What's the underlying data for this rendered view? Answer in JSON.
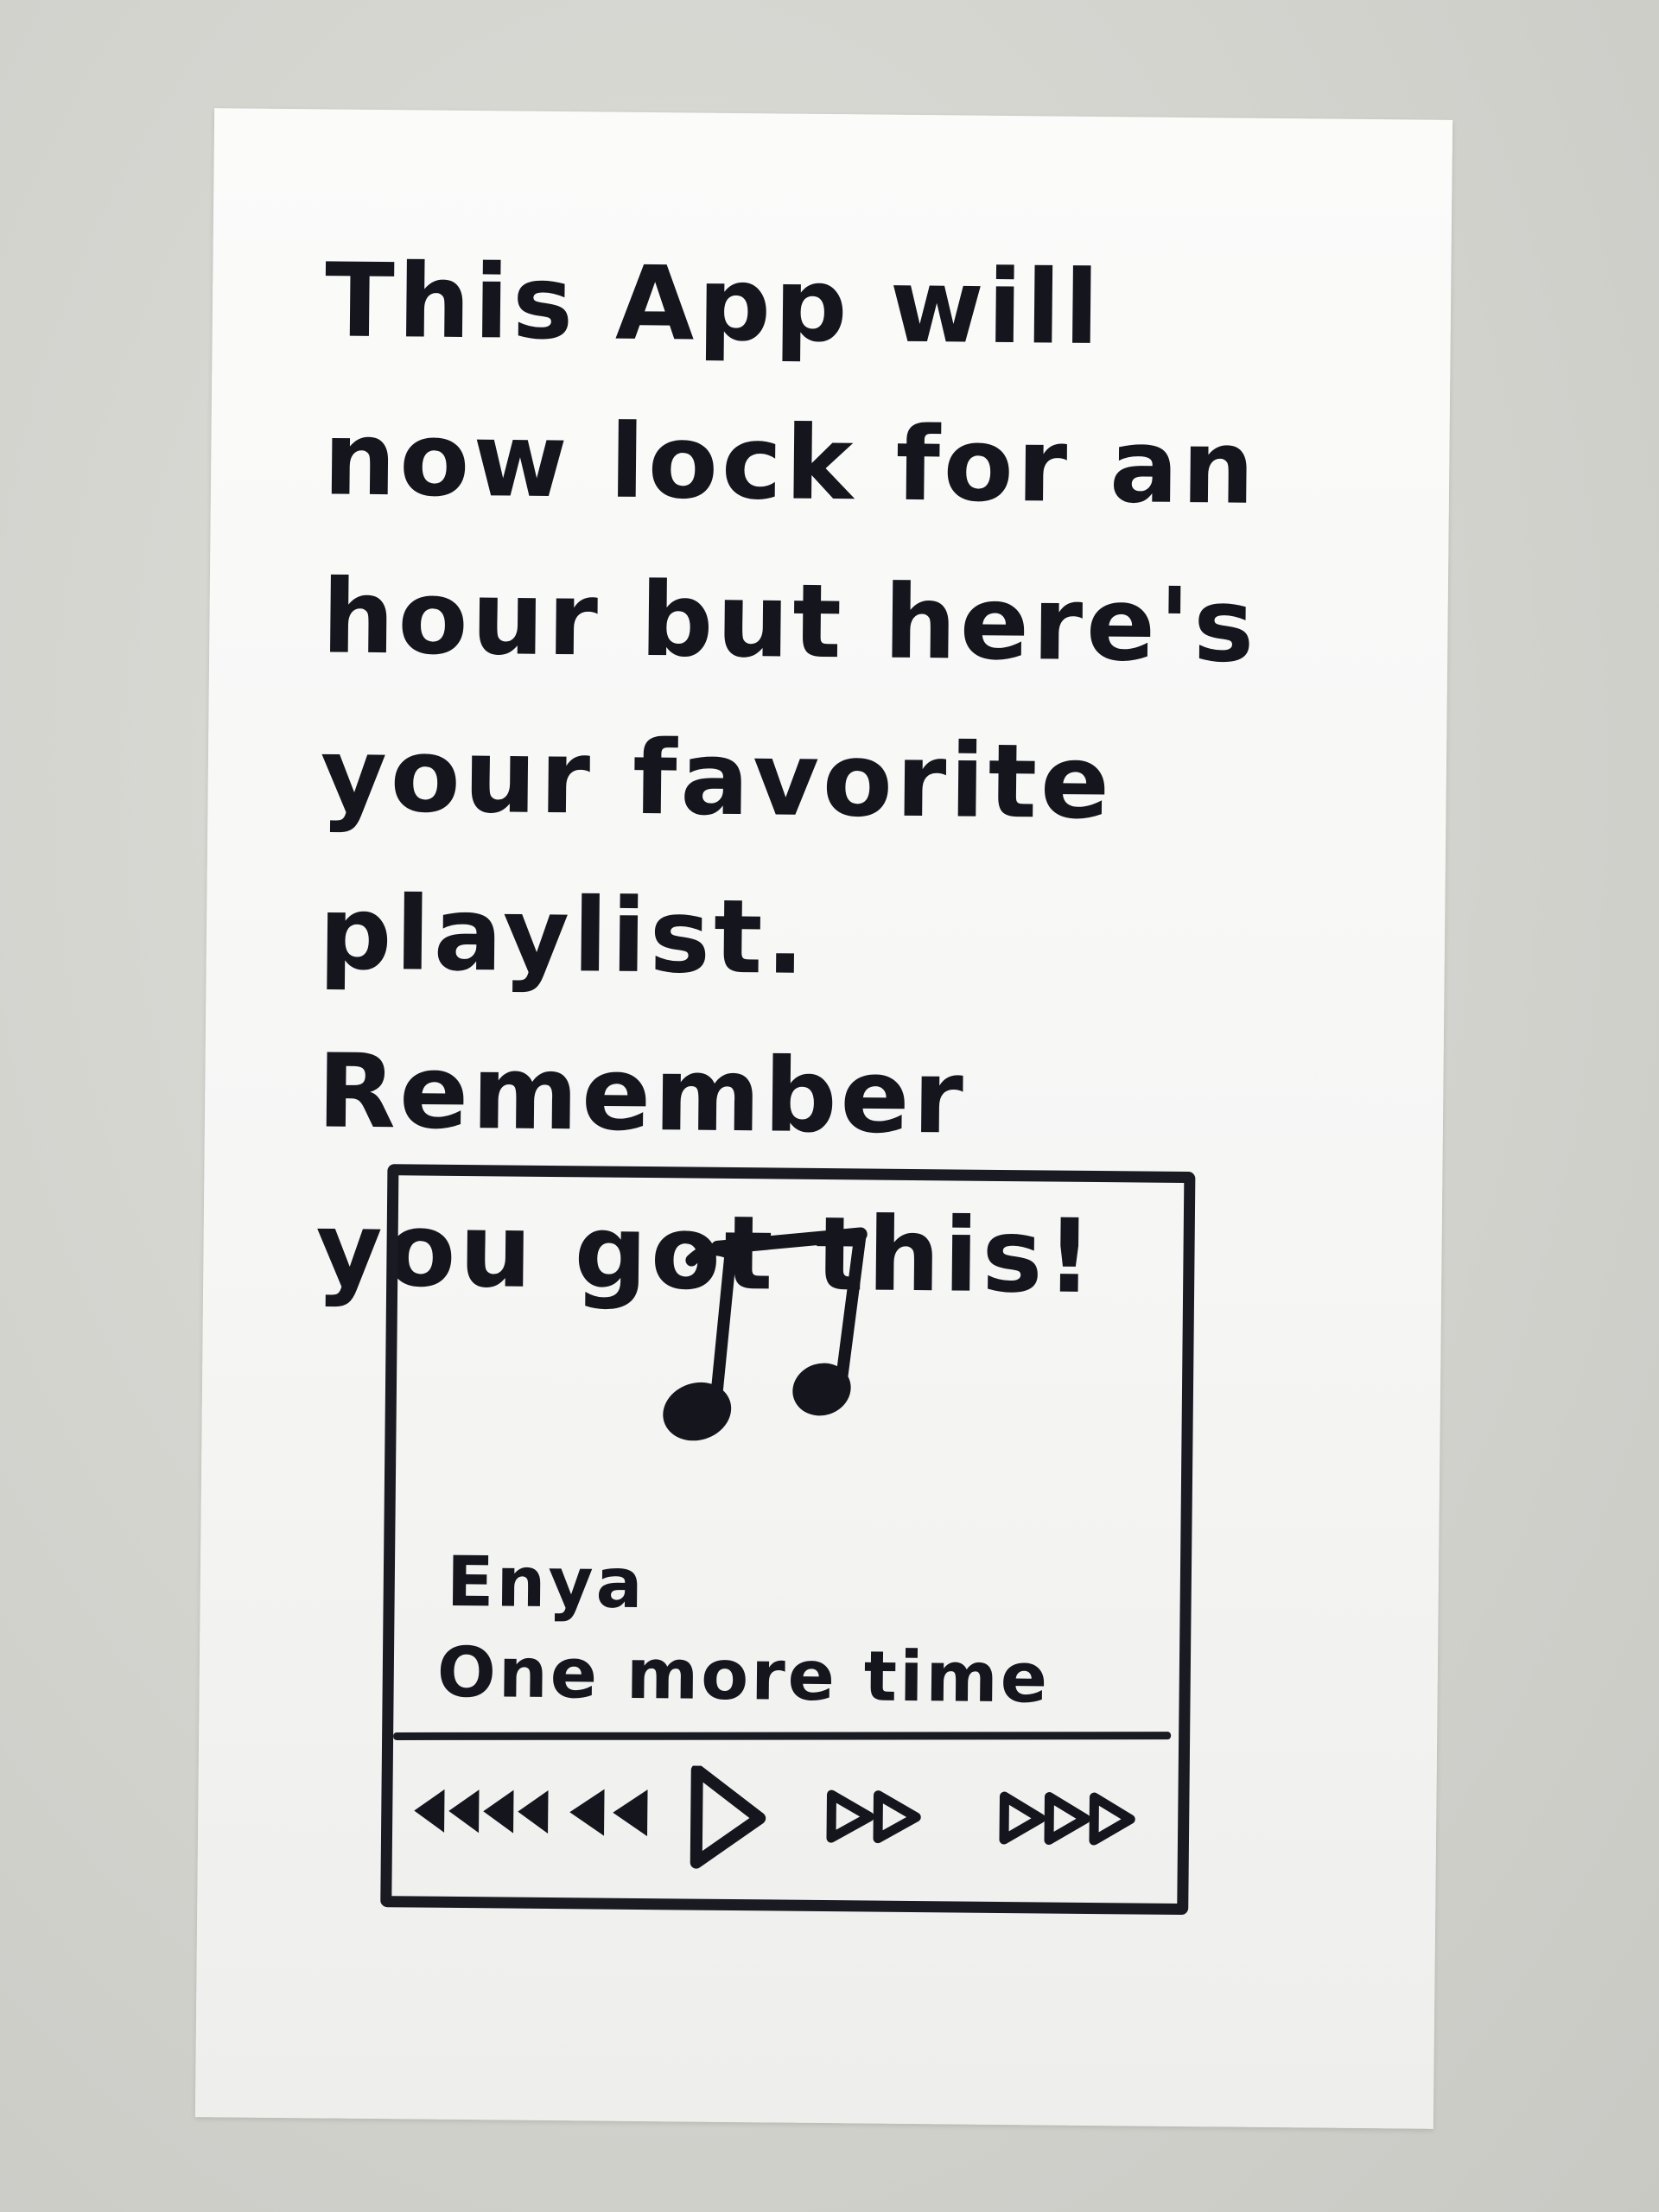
{
  "message": {
    "text": "This App will\nnow lock for an\nhour but here's\nyour favorite\nplaylist. Remember\nyou got this!"
  },
  "player": {
    "artwork_icon": "music-note-icon",
    "artist": "Enya",
    "song": "One more time",
    "controls": [
      {
        "name": "skip-back-icon"
      },
      {
        "name": "rewind-icon"
      },
      {
        "name": "play-icon"
      },
      {
        "name": "fast-forward-icon"
      },
      {
        "name": "skip-forward-icon"
      }
    ]
  },
  "colors": {
    "ink": "#15161d",
    "paper": "#f8f8f7",
    "background": "#d6d6d1"
  }
}
